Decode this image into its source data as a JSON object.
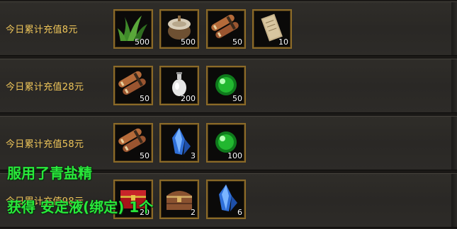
{
  "rows": [
    {
      "label": "今日累计充值8元",
      "items": [
        {
          "icon": "grass-herb-icon",
          "qty": "500"
        },
        {
          "icon": "wooden-drum-icon",
          "qty": "500"
        },
        {
          "icon": "scroll-bundle-icon",
          "qty": "50"
        },
        {
          "icon": "paper-sheet-icon",
          "qty": "10"
        }
      ]
    },
    {
      "label": "今日累计充值28元",
      "items": [
        {
          "icon": "scroll-bundle-icon",
          "qty": "50"
        },
        {
          "icon": "white-potion-bottle-icon",
          "qty": "200"
        },
        {
          "icon": "green-orb-icon",
          "qty": "50"
        }
      ]
    },
    {
      "label": "今日累计充值58元",
      "items": [
        {
          "icon": "scroll-bundle-icon",
          "qty": "50"
        },
        {
          "icon": "blue-crystal-icon",
          "qty": "3"
        },
        {
          "icon": "green-orb-icon",
          "qty": "100"
        }
      ]
    },
    {
      "label": "今日累计充值98元",
      "items": [
        {
          "icon": "red-treasure-box-icon",
          "qty": "20"
        },
        {
          "icon": "wooden-chest-icon",
          "qty": "2"
        },
        {
          "icon": "blue-crystal-icon",
          "qty": "6"
        }
      ]
    }
  ],
  "messages": {
    "line1": "服用了青盐精",
    "line2": "获得 安定液(绑定) 1个"
  },
  "colors": {
    "label_gold": "#efc65a",
    "message_green": "#29e83b",
    "slot_border": "#8b6a28"
  }
}
